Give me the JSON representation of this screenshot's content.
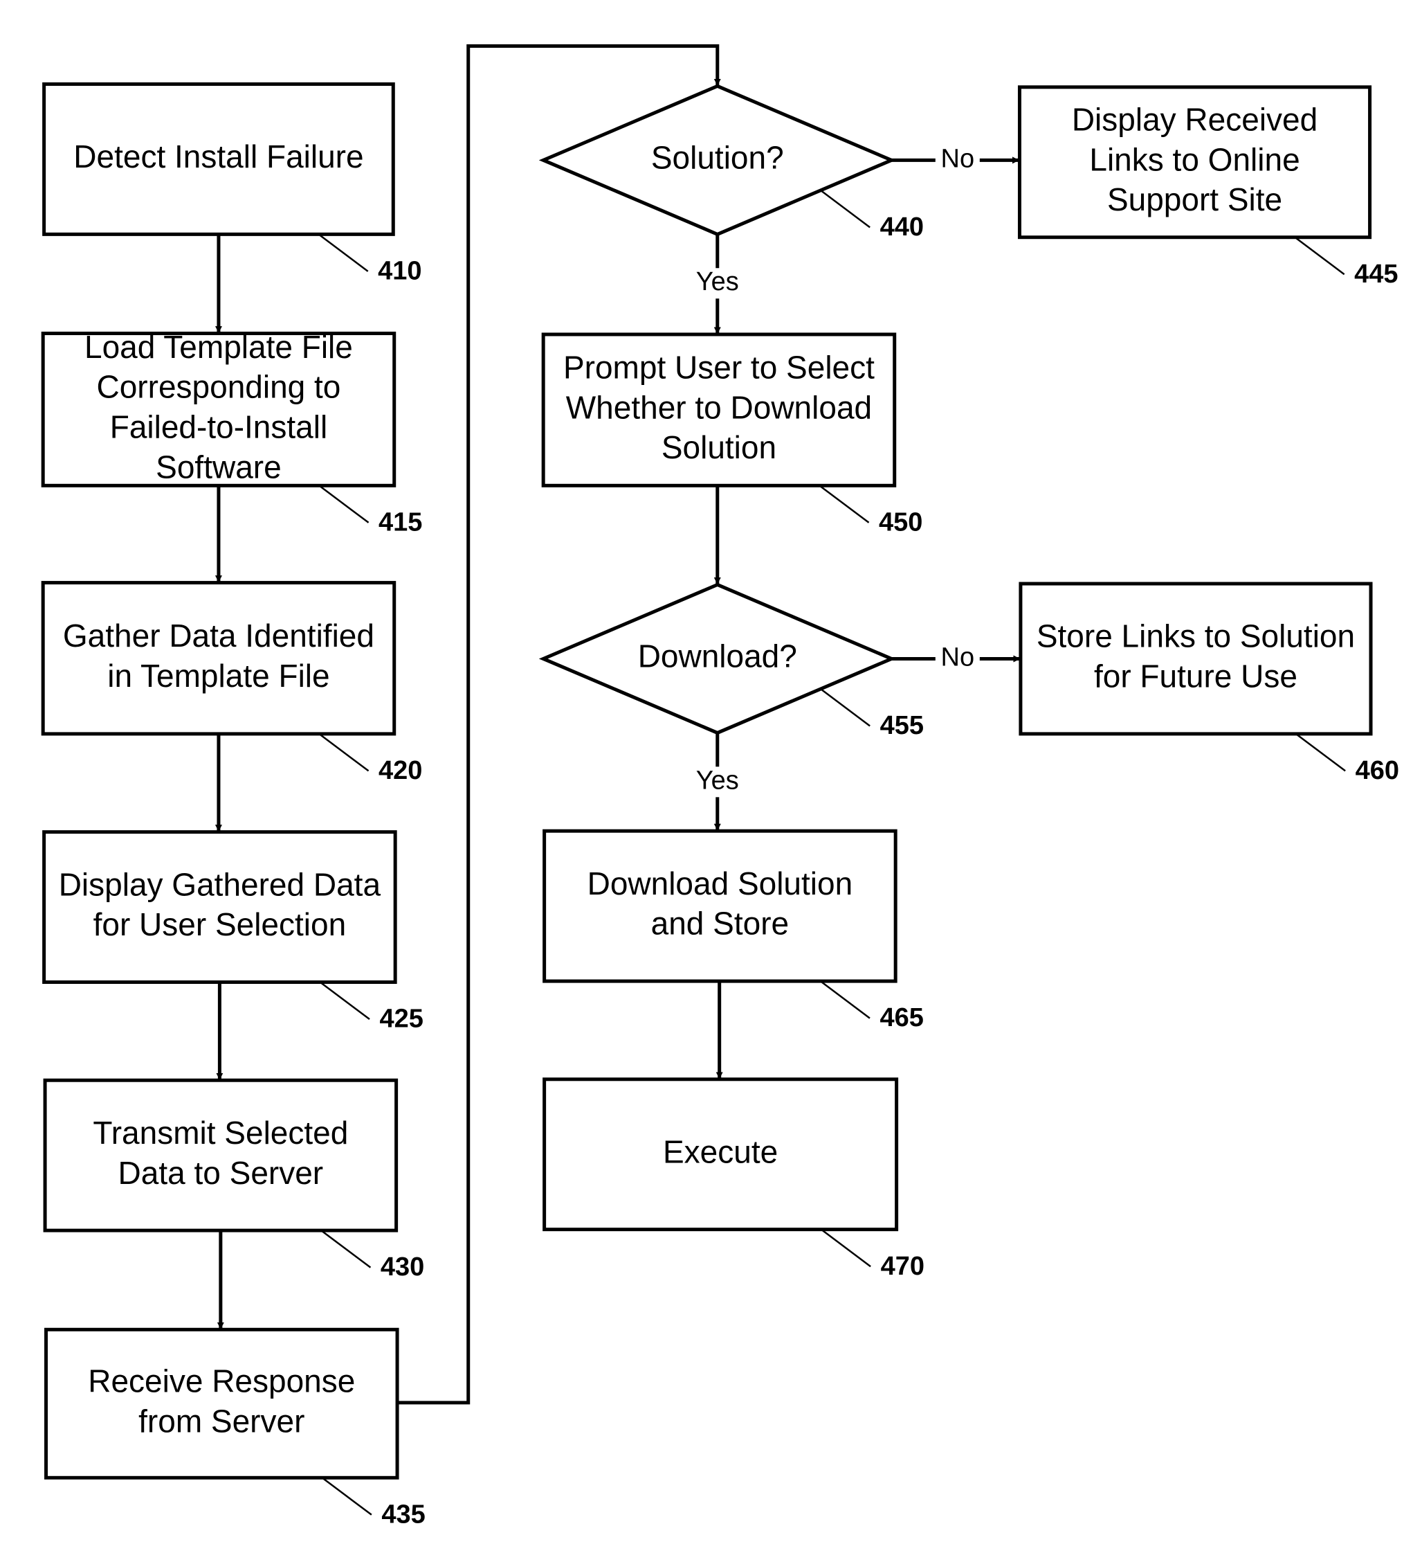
{
  "diagram": {
    "type": "flowchart",
    "nodes": [
      {
        "id": "410",
        "shape": "rect",
        "ref": "410",
        "lines": [
          "Detect Install Failure"
        ]
      },
      {
        "id": "415",
        "shape": "rect",
        "ref": "415",
        "lines": [
          "Load Template File",
          "Corresponding to",
          "Failed-to-Install",
          "Software"
        ]
      },
      {
        "id": "420",
        "shape": "rect",
        "ref": "420",
        "lines": [
          "Gather Data Identified",
          "in Template File"
        ]
      },
      {
        "id": "425",
        "shape": "rect",
        "ref": "425",
        "lines": [
          "Display Gathered Data",
          "for User Selection"
        ]
      },
      {
        "id": "430",
        "shape": "rect",
        "ref": "430",
        "lines": [
          "Transmit Selected",
          "Data to Server"
        ]
      },
      {
        "id": "435",
        "shape": "rect",
        "ref": "435",
        "lines": [
          "Receive Response",
          "from Server"
        ]
      },
      {
        "id": "440",
        "shape": "diamond",
        "ref": "440",
        "lines": [
          "Solution?"
        ]
      },
      {
        "id": "445",
        "shape": "rect",
        "ref": "445",
        "lines": [
          "Display Received",
          "Links to Online",
          "Support Site"
        ]
      },
      {
        "id": "450",
        "shape": "rect",
        "ref": "450",
        "lines": [
          "Prompt User to Select",
          "Whether to Download",
          "Solution"
        ]
      },
      {
        "id": "455",
        "shape": "diamond",
        "ref": "455",
        "lines": [
          "Download?"
        ]
      },
      {
        "id": "460",
        "shape": "rect",
        "ref": "460",
        "lines": [
          "Store Links to Solution",
          "for Future Use"
        ]
      },
      {
        "id": "465",
        "shape": "rect",
        "ref": "465",
        "lines": [
          "Download Solution",
          "and Store"
        ]
      },
      {
        "id": "470",
        "shape": "rect",
        "ref": "470",
        "lines": [
          "Execute"
        ]
      }
    ],
    "edges": [
      {
        "from": "410",
        "to": "415",
        "label": ""
      },
      {
        "from": "415",
        "to": "420",
        "label": ""
      },
      {
        "from": "420",
        "to": "425",
        "label": ""
      },
      {
        "from": "425",
        "to": "430",
        "label": ""
      },
      {
        "from": "430",
        "to": "435",
        "label": ""
      },
      {
        "from": "435",
        "to": "440",
        "label": ""
      },
      {
        "from": "440",
        "to": "445",
        "label": "No"
      },
      {
        "from": "440",
        "to": "450",
        "label": "Yes"
      },
      {
        "from": "450",
        "to": "455",
        "label": ""
      },
      {
        "from": "455",
        "to": "460",
        "label": "No"
      },
      {
        "from": "455",
        "to": "465",
        "label": "Yes"
      },
      {
        "from": "465",
        "to": "470",
        "label": ""
      }
    ]
  }
}
